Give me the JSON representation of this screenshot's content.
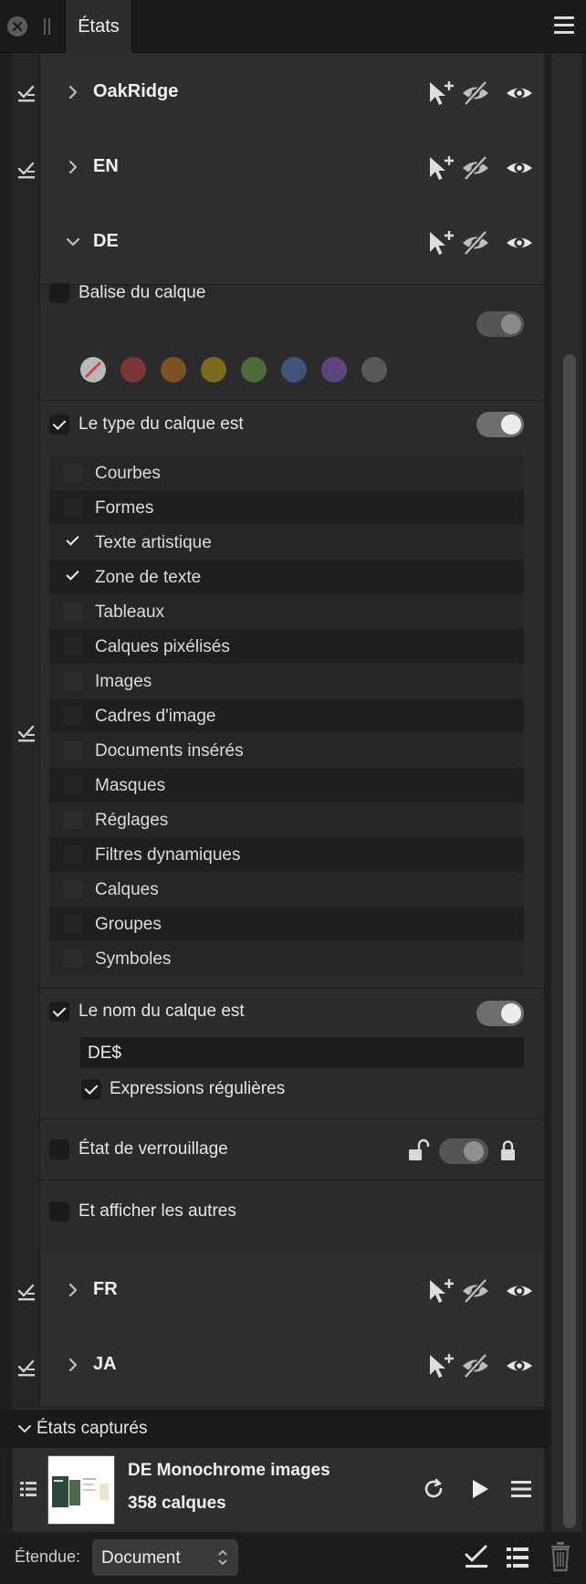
{
  "window": {
    "tab_title": "États",
    "close_icon": "close-circle-icon",
    "menu_icon": "hamburger-menu-icon"
  },
  "states": [
    {
      "name": "OakRidge",
      "expanded": false
    },
    {
      "name": "EN",
      "expanded": false
    },
    {
      "name": "DE",
      "expanded": true
    },
    {
      "name": "FR",
      "expanded": false
    },
    {
      "name": "JA",
      "expanded": false
    }
  ],
  "row_icons": [
    "select-cursor-plus-icon",
    "hide-eye-slash-icon",
    "show-eye-icon"
  ],
  "de_panel": {
    "layer_tag": {
      "label": "Balise du calque",
      "checked": false,
      "toggle_on": false,
      "swatches": [
        "#b9b9b9",
        "#7c3636",
        "#7d5223",
        "#7c6a1f",
        "#4e6a36",
        "#3f5478",
        "#5d447e",
        "#585858"
      ]
    },
    "layer_type": {
      "label": "Le type du calque est",
      "checked": true,
      "toggle_on": true,
      "types": [
        {
          "label": "Courbes",
          "checked": false
        },
        {
          "label": "Formes",
          "checked": false
        },
        {
          "label": "Texte artistique",
          "checked": true
        },
        {
          "label": "Zone de texte",
          "checked": true
        },
        {
          "label": "Tableaux",
          "checked": false
        },
        {
          "label": "Calques pixélisés",
          "checked": false
        },
        {
          "label": "Images",
          "checked": false
        },
        {
          "label": "Cadres d'image",
          "checked": false
        },
        {
          "label": "Documents insérés",
          "checked": false
        },
        {
          "label": "Masques",
          "checked": false
        },
        {
          "label": "Réglages",
          "checked": false
        },
        {
          "label": "Filtres dynamiques",
          "checked": false
        },
        {
          "label": "Calques",
          "checked": false
        },
        {
          "label": "Groupes",
          "checked": false
        },
        {
          "label": "Symboles",
          "checked": false
        }
      ]
    },
    "layer_name": {
      "label": "Le nom du calque est",
      "checked": true,
      "toggle_on": true,
      "value": "DE$",
      "regex_label": "Expressions régulières",
      "regex_checked": true
    },
    "lock_state": {
      "label": "État de verrouillage",
      "checked": false
    },
    "show_others": {
      "label": "Et afficher les autres",
      "checked": false
    }
  },
  "captured": {
    "title": "États capturés",
    "snapshot": {
      "name": "DE Monochrome images",
      "count": "358 calques"
    }
  },
  "footer": {
    "scope_label": "Étendue:",
    "scope_value": "Document"
  },
  "colors": {
    "panel": "#2e2e2e",
    "background": "#1e1e1e",
    "text": "#e6e6e6"
  }
}
